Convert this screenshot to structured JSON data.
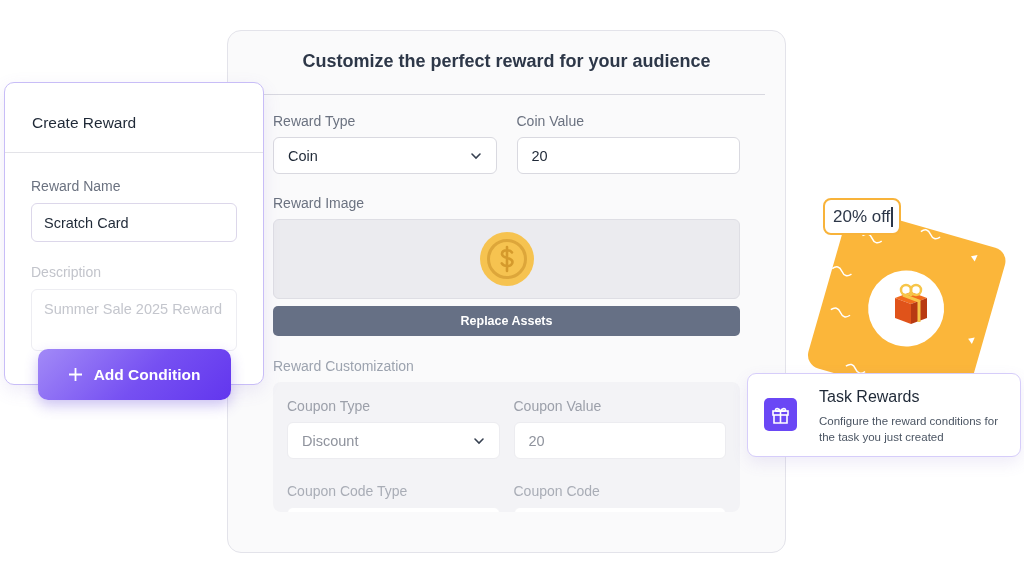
{
  "main_panel": {
    "title": "Customize the perfect reward for your audience",
    "fields": [
      {
        "kind": "select",
        "label": "Reward Type",
        "value": "Coin"
      },
      {
        "kind": "input",
        "label": "Coin Value",
        "value": "20"
      }
    ],
    "image_label": "Reward Image",
    "replace_button": "Replace Assets",
    "customization": {
      "label": "Reward Customization",
      "fields": [
        {
          "kind": "select",
          "label": "Coupon Type",
          "value": "Discount"
        },
        {
          "kind": "input",
          "label": "Coupon Value",
          "value": "20"
        },
        {
          "kind": "input",
          "label": "Coupon Code Type"
        },
        {
          "kind": "input",
          "label": "Coupon Code"
        }
      ]
    }
  },
  "create_card": {
    "title": "Create Reward",
    "fields": [
      {
        "kind": "input",
        "label": "Reward Name",
        "value": "Scratch Card"
      },
      {
        "kind": "textarea",
        "label": "Description",
        "placeholder": "Summer Sale 2025 Reward"
      }
    ],
    "button": "Add Condition"
  },
  "reward_tag": {
    "value": "20% off"
  },
  "task_card": {
    "title": "Task Rewards",
    "description": "Configure the reward conditions for the task you just created"
  }
}
